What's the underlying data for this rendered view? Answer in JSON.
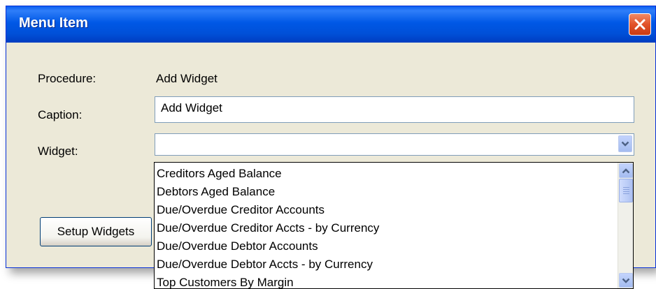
{
  "window": {
    "title": "Menu Item"
  },
  "form": {
    "procedure_label": "Procedure:",
    "procedure_value": "Add Widget",
    "caption_label": "Caption:",
    "caption_value": "Add Widget",
    "widget_label": "Widget:",
    "widget_value": "",
    "setup_button": "Setup Widgets"
  },
  "dropdown": {
    "items": [
      "Creditors Aged Balance",
      "Debtors Aged Balance",
      "Due/Overdue Creditor Accounts",
      "Due/Overdue Creditor Accts - by Currency",
      "Due/Overdue Debtor Accounts",
      "Due/Overdue Debtor Accts - by Currency",
      "Top Customers By Margin"
    ]
  },
  "icons": {
    "close": "close-icon",
    "combo_arrow": "chevron-down-icon",
    "scroll_up": "chevron-up-icon",
    "scroll_down": "chevron-down-icon"
  },
  "colors": {
    "titlebar": "#0058e6",
    "window_bg": "#ece9d8",
    "close_button": "#e2532a",
    "input_border": "#7f9db9"
  }
}
